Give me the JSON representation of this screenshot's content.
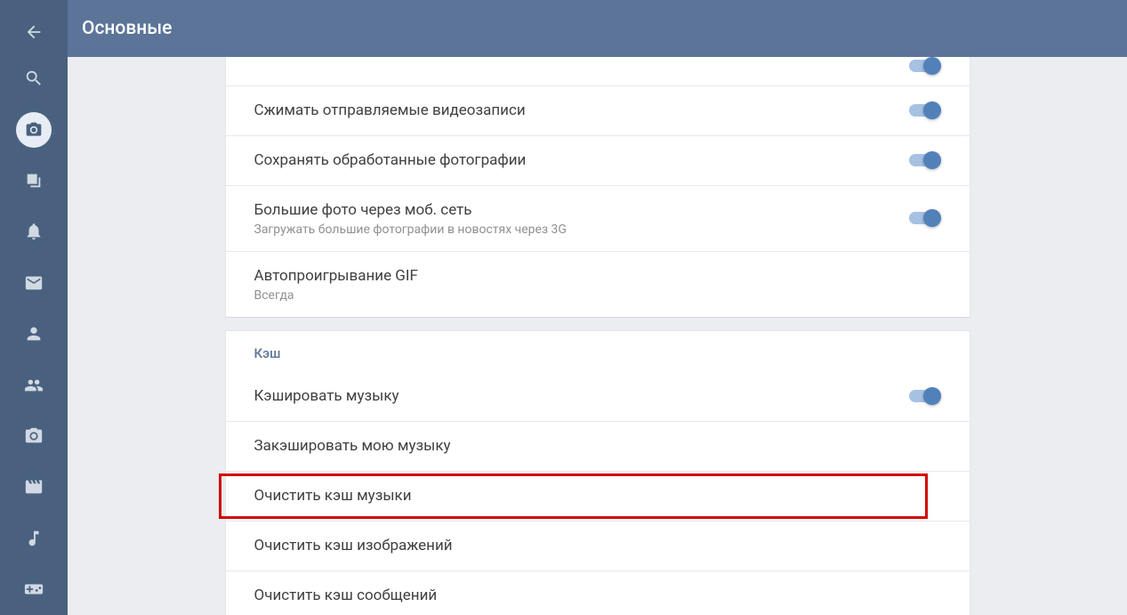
{
  "header": {
    "title": "Основные"
  },
  "sidebar": {
    "items": [
      {
        "name": "back-icon"
      },
      {
        "name": "search-icon"
      },
      {
        "name": "camera-icon",
        "active": true
      },
      {
        "name": "news-icon"
      },
      {
        "name": "bell-icon"
      },
      {
        "name": "mail-icon"
      },
      {
        "name": "person-icon"
      },
      {
        "name": "group-icon"
      },
      {
        "name": "photo-icon"
      },
      {
        "name": "video-icon"
      },
      {
        "name": "music-icon"
      },
      {
        "name": "gamepad-icon"
      }
    ]
  },
  "card1": {
    "rows": [
      {
        "title": "Сжимать отправляемые видеозаписи",
        "toggle": true
      },
      {
        "title": "Сохранять обработанные фотографии",
        "toggle": true
      },
      {
        "title": "Большие фото через моб. сеть",
        "sub": "Загружать большие фотографии в новостях через 3G",
        "toggle": true
      },
      {
        "title": "Автопроигрывание GIF",
        "sub": "Всегда"
      }
    ]
  },
  "card2": {
    "section": "Кэш",
    "rows": [
      {
        "title": "Кэшировать музыку",
        "toggle": true
      },
      {
        "title": "Закэшировать мою музыку"
      },
      {
        "title": "Очистить кэш музыки",
        "highlight": true
      },
      {
        "title": "Очистить кэш изображений"
      },
      {
        "title": "Очистить кэш сообщений"
      }
    ]
  }
}
